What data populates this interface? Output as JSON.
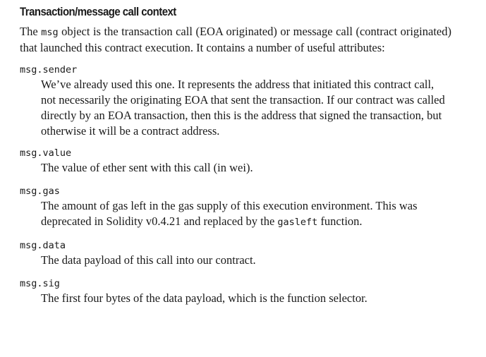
{
  "section": {
    "heading": "Transaction/message call context",
    "intro_before": "The ",
    "intro_code": "msg",
    "intro_after": " object is the transaction call (EOA originated) or message call (contract ori­ginated) that launched this contract execution. It contains a number of useful attributes:"
  },
  "attributes": [
    {
      "term": "msg.sender",
      "description": "We’ve already used this one. It represents the address that initiated this contract call, not necessarily the originating EOA that sent the transaction. If our contract was called directly by an EOA transaction, then this is the address that signed the transaction, but otherwise it will be a contract address."
    },
    {
      "term": "msg.value",
      "description": "The value of ether sent with this call (in wei)."
    },
    {
      "term": "msg.gas",
      "description_before": "The amount of gas left in the gas supply of this execution environment. This was deprecated in Solidity v0.4.21 and replaced by the ",
      "description_code": "gasleft",
      "description_after": " function."
    },
    {
      "term": "msg.data",
      "description": "The data payload of this call into our contract."
    },
    {
      "term": "msg.sig",
      "description": "The first four bytes of the data payload, which is the function selector."
    }
  ]
}
